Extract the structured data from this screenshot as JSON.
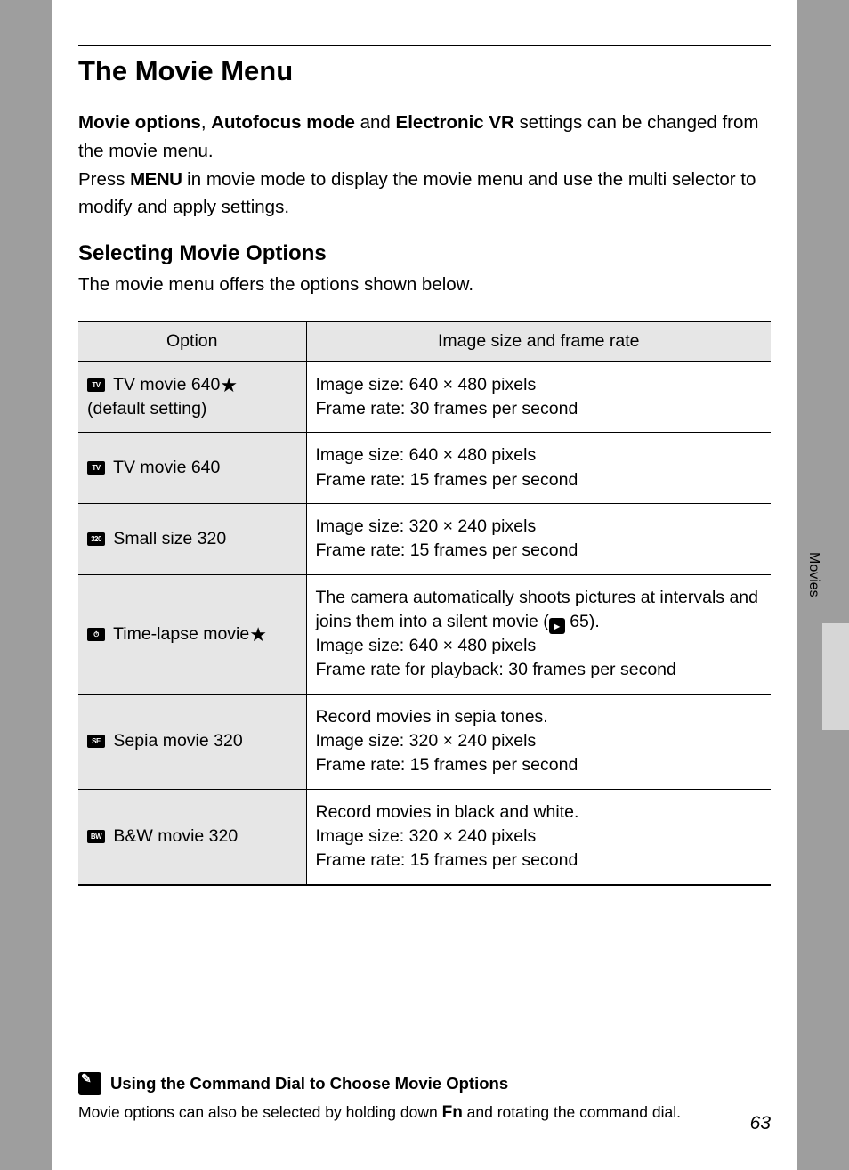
{
  "heading": "The Movie Menu",
  "intro": {
    "b1": "Movie options",
    "sep1": ", ",
    "b2": "Autofocus mode",
    "sep2": " and ",
    "b3": "Electronic VR",
    "rest1": " settings can be changed from the movie menu.",
    "line2a": "Press ",
    "menu": "MENU",
    "line2b": " in movie mode to display the movie menu and use the multi selector to modify and apply settings."
  },
  "subheading": "Selecting Movie Options",
  "subtext": "The movie menu offers the options shown below.",
  "table": {
    "head_option": "Option",
    "head_desc": "Image size and frame rate",
    "rows": [
      {
        "icon": "TV",
        "label_a": " TV movie 640",
        "star": "★",
        "label_b": "(default setting)",
        "desc": "Image size: 640 × 480 pixels\nFrame rate: 30 frames per second"
      },
      {
        "icon": "TV",
        "label_a": " TV movie 640",
        "star": "",
        "label_b": "",
        "desc": "Image size: 640 × 480 pixels\nFrame rate: 15 frames per second"
      },
      {
        "icon": "320",
        "label_a": " Small size 320",
        "star": "",
        "label_b": "",
        "desc": "Image size: 320 × 240 pixels\nFrame rate: 15 frames per second"
      },
      {
        "icon": "⏱",
        "label_a": " Time-lapse movie",
        "star": "★",
        "label_b": "",
        "desc_pre": "The camera automatically shoots pictures at intervals and joins them into a silent movie (",
        "ref": "65",
        "desc_post": ").\nImage size: 640 × 480 pixels\nFrame rate for playback: 30 frames per second"
      },
      {
        "icon": "SE",
        "label_a": " Sepia movie 320",
        "star": "",
        "label_b": "",
        "desc": "Record movies in sepia tones.\nImage size: 320 × 240 pixels\nFrame rate: 15 frames per second"
      },
      {
        "icon": "BW",
        "label_a": " B&W movie 320",
        "star": "",
        "label_b": "",
        "desc": "Record movies in black and white.\nImage size: 320 × 240 pixels\nFrame rate: 15 frames per second"
      }
    ]
  },
  "side_label": "Movies",
  "tip": {
    "title": "Using the Command Dial to Choose Movie Options",
    "body_a": "Movie options can also be selected by holding down ",
    "fn": "Fn",
    "body_b": " and rotating the command dial."
  },
  "page_number": "63"
}
